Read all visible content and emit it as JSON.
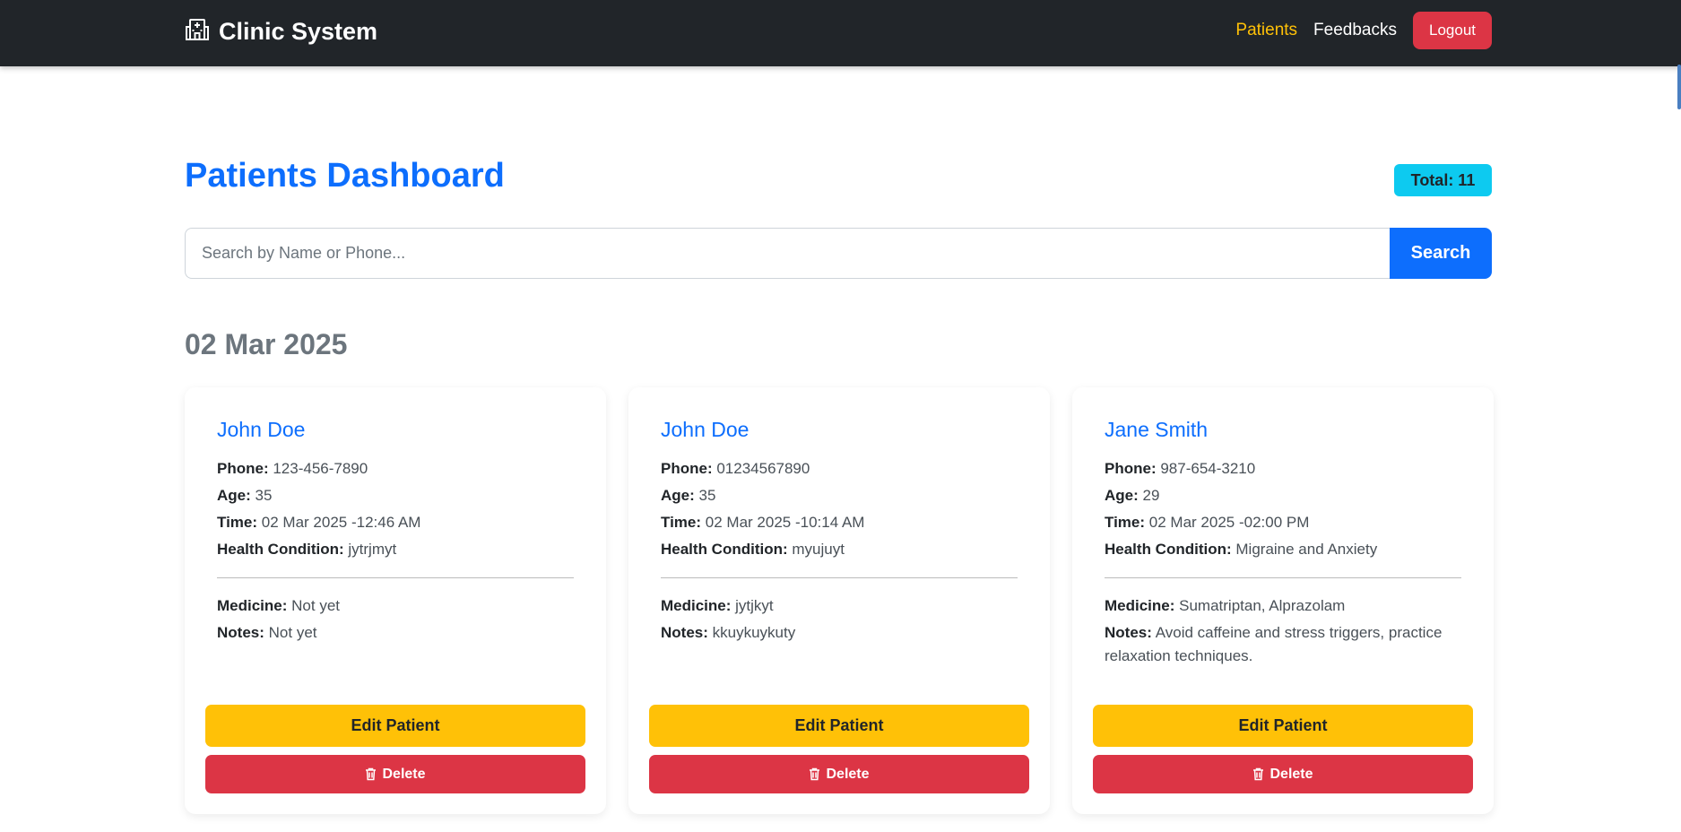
{
  "navbar": {
    "brand_icon": "hospital-icon",
    "brand": "Clinic System",
    "links": [
      "Patients",
      "Feedbacks"
    ],
    "logout": "Logout"
  },
  "page": {
    "title": "Patients Dashboard",
    "total": "Total: 11"
  },
  "search": {
    "placeholder": "Search by Name or Phone...",
    "button": "Search"
  },
  "date_heading": "02 Mar 2025",
  "labels": {
    "phone": "Phone:",
    "age": "Age:",
    "time": "Time:",
    "condition": "Health Condition:",
    "medicine": "Medicine:",
    "notes": "Notes:"
  },
  "buttons": {
    "edit": "Edit Patient",
    "delete": "Delete",
    "delete_icon": "trash-icon"
  },
  "patients": [
    {
      "name": "John Doe",
      "phone": "123-456-7890",
      "age": "35",
      "time": "02 Mar 2025 -12:46 AM",
      "condition": "jytrjmyt",
      "medicine": "Not yet",
      "notes": "Not yet"
    },
    {
      "name": "John Doe",
      "phone": "01234567890",
      "age": "35",
      "time": "02 Mar 2025 -10:14 AM",
      "condition": "myujuyt",
      "medicine": "jytjkyt",
      "notes": "kkuykuykuty"
    },
    {
      "name": "Jane Smith",
      "phone": "987-654-3210",
      "age": "29",
      "time": "02 Mar 2025 -02:00 PM",
      "condition": "Migraine and Anxiety",
      "medicine": "Sumatriptan, Alprazolam",
      "notes": "Avoid caffeine and stress triggers, practice relaxation techniques."
    }
  ],
  "colors": {
    "navbar_bg": "#212529",
    "primary": "#0d6efd",
    "warning": "#ffc107",
    "danger": "#dc3545",
    "info": "#0dcaf0",
    "active_link": "#ffc107"
  }
}
